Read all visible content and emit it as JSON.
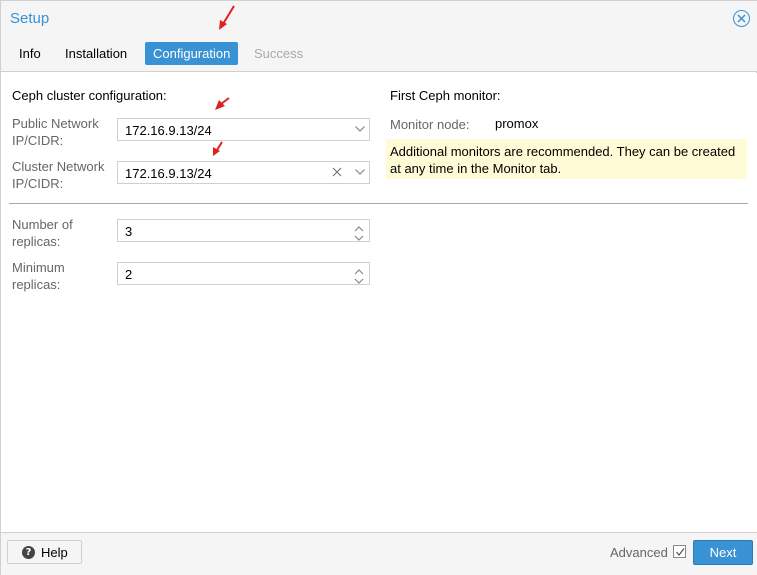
{
  "window": {
    "title": "Setup",
    "close_icon": "close-circle-icon"
  },
  "tabs": [
    {
      "label": "Info",
      "state": "normal"
    },
    {
      "label": "Installation",
      "state": "normal"
    },
    {
      "label": "Configuration",
      "state": "active"
    },
    {
      "label": "Success",
      "state": "disabled"
    }
  ],
  "cluster_config": {
    "title": "Ceph cluster configuration:",
    "public_network": {
      "label_line1": "Public Network",
      "label_line2": "IP/CIDR:",
      "value": "172.16.9.13/24"
    },
    "cluster_network": {
      "label_line1": "Cluster Network",
      "label_line2": "IP/CIDR:",
      "value": "172.16.9.13/24"
    },
    "replicas": {
      "label_line1": "Number of",
      "label_line2": "replicas:",
      "value": "3"
    },
    "min_replicas": {
      "label_line1": "Minimum",
      "label_line2": "replicas:",
      "value": "2"
    }
  },
  "monitor": {
    "title": "First Ceph monitor:",
    "node_label": "Monitor node:",
    "node_value": "promox",
    "notice": "Additional monitors are recommended. They can be created at any time in the Monitor tab."
  },
  "footer": {
    "help_label": "Help",
    "help_icon": "question-circle-icon",
    "advanced_label": "Advanced",
    "advanced_checked": true,
    "next_label": "Next"
  },
  "colors": {
    "accent": "#3892d4",
    "notice_bg": "#fffbd6",
    "annotation_arrow": "#e02020"
  }
}
